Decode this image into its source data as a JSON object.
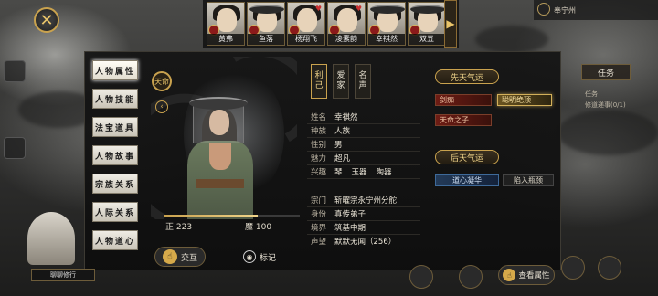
{
  "header": {
    "close_icon": "close-x-icon",
    "party": [
      {
        "name": "黄弗",
        "heart": false
      },
      {
        "name": "鱼落",
        "heart": false
      },
      {
        "name": "杨翔飞",
        "heart": true
      },
      {
        "name": "凌素韵",
        "heart": true
      },
      {
        "name": "幸祺然",
        "heart": false
      },
      {
        "name": "双五",
        "heart": false
      }
    ],
    "region": "奉宁州"
  },
  "quest_tracker": {
    "tab_label": "任务",
    "rows": [
      "任务",
      "修道递事(0/1)"
    ]
  },
  "side_tabs": [
    "人物属性",
    "人物技能",
    "法宝道具",
    "人物故事",
    "宗族关系",
    "人际关系",
    "人物道心"
  ],
  "portrait": {
    "fate_badge": "天命",
    "righteous_label": "正",
    "righteous_value": "223",
    "demonic_label": "魔",
    "demonic_value": "100",
    "interact_label": "交互",
    "mark_label": "标记",
    "alignment_fill": 0.69
  },
  "stat_columns": [
    {
      "label": "利己",
      "active": true
    },
    {
      "label": "爱家",
      "active": false
    },
    {
      "label": "名声",
      "active": false
    }
  ],
  "profile": {
    "basic": [
      {
        "key": "姓名",
        "value": "幸祺然"
      },
      {
        "key": "种族",
        "value": "人族"
      },
      {
        "key": "性别",
        "value": "男"
      },
      {
        "key": "魅力",
        "value": "超凡"
      }
    ],
    "interests_key": "兴趣",
    "interests": [
      "琴",
      "玉器",
      "陶器"
    ],
    "affiliation": [
      {
        "key": "宗门",
        "value": "斩曜宗永宁州分舵"
      },
      {
        "key": "身份",
        "value": "真传弟子"
      },
      {
        "key": "境界",
        "value": "筑基中期"
      },
      {
        "key": "声望",
        "value": "默默无闻（256）"
      }
    ]
  },
  "innate_fortune": {
    "title": "先天气运",
    "traits": [
      {
        "label": "剑痴",
        "style": "red"
      },
      {
        "label": "聪明绝顶",
        "style": "gold"
      },
      {
        "label": "天命之子",
        "style": "red"
      }
    ]
  },
  "acquired_fortune": {
    "title": "后天气运",
    "traits": [
      {
        "label": "道心凝华",
        "style": "blue"
      },
      {
        "label": "陷入瓶颈",
        "style": "plain"
      }
    ]
  },
  "footer": {
    "view_attributes": "查看属性",
    "dock_label": "聊聊修行"
  },
  "colors": {
    "gold": "#c9a24e",
    "red_trait": "#6e1c14",
    "blue_trait": "#233a58"
  }
}
